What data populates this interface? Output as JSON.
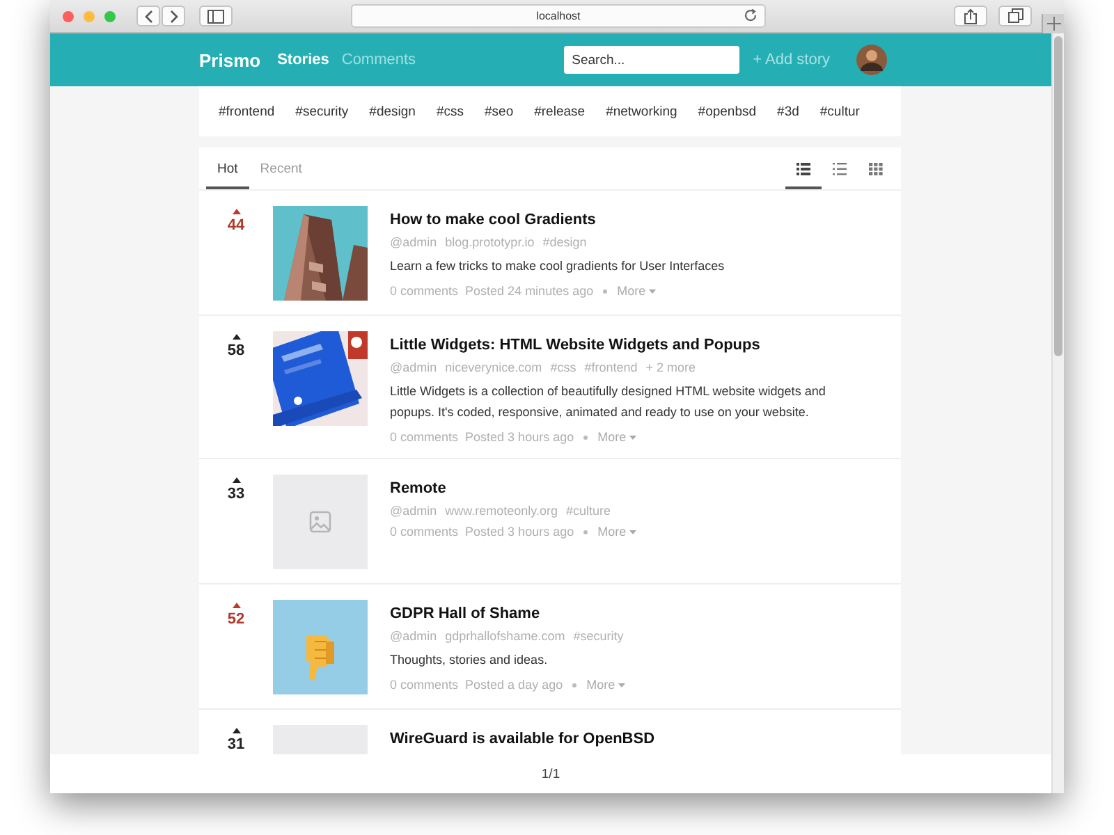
{
  "browser": {
    "url": "localhost"
  },
  "header": {
    "brand": "Prismo",
    "nav": [
      {
        "label": "Stories",
        "selected": true
      },
      {
        "label": "Comments",
        "selected": false
      }
    ],
    "search": {
      "placeholder": "Search..."
    },
    "add_story": "+ Add story"
  },
  "tags": [
    "#frontend",
    "#security",
    "#design",
    "#css",
    "#seo",
    "#release",
    "#networking",
    "#openbsd",
    "#3d",
    "#cultur"
  ],
  "tabs": [
    {
      "label": "Hot",
      "selected": true
    },
    {
      "label": "Recent",
      "selected": false
    }
  ],
  "views": [
    {
      "kind": "cards",
      "selected": true
    },
    {
      "kind": "list",
      "selected": false
    },
    {
      "kind": "grid",
      "selected": false
    }
  ],
  "stories": [
    {
      "votes": "44",
      "voted": true,
      "title": "How to make cool Gradients",
      "meta": [
        "@admin",
        "blog.prototypr.io",
        "#design"
      ],
      "description": "Learn a few tricks to make cool gradients for User Interfaces",
      "comments": "0 comments",
      "posted": "Posted 24 minutes ago",
      "more": "More"
    },
    {
      "votes": "58",
      "voted": false,
      "title": "Little Widgets: HTML Website Widgets and Popups",
      "meta": [
        "@admin",
        "niceverynice.com",
        "#css",
        "#frontend",
        "+ 2 more"
      ],
      "description": "Little Widgets is a collection of beautifully designed HTML website widgets and popups. It's coded, responsive, animated and ready to use on your website.",
      "comments": "0 comments",
      "posted": "Posted 3 hours ago",
      "more": "More"
    },
    {
      "votes": "33",
      "voted": false,
      "thumb": {
        "kind": "placeholder"
      },
      "title": "Remote",
      "meta": [
        "@admin",
        "www.remoteonly.org",
        "#culture"
      ],
      "comments": "0 comments",
      "posted": "Posted 3 hours ago",
      "more": "More"
    },
    {
      "votes": "52",
      "voted": true,
      "title": "GDPR Hall of Shame",
      "meta": [
        "@admin",
        "gdprhallofshame.com",
        "#security"
      ],
      "description": "Thoughts, stories and ideas.",
      "comments": "0 comments",
      "posted": "Posted a day ago",
      "more": "More"
    },
    {
      "votes": "31",
      "voted": false,
      "thumb": {
        "kind": "blank"
      },
      "title": "WireGuard is available for OpenBSD"
    }
  ],
  "pager": "1/1"
}
